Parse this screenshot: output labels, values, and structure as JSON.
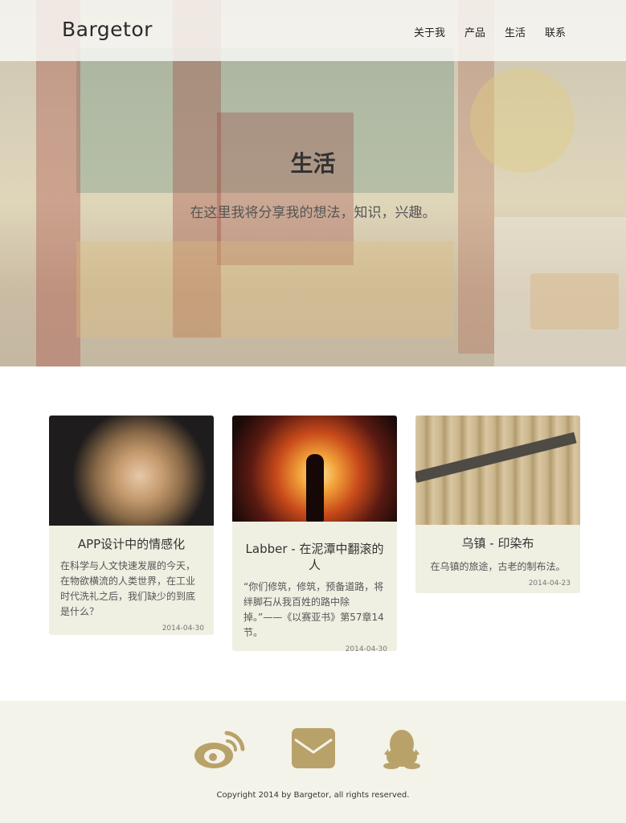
{
  "header": {
    "logo": "Bargetor",
    "nav": [
      "关于我",
      "产品",
      "生活",
      "联系"
    ]
  },
  "hero": {
    "title": "生活",
    "subtitle": "在这里我将分享我的想法，知识，兴趣。"
  },
  "cards": [
    {
      "title": "APP设计中的情感化",
      "desc": "在科学与人文快速发展的今天，在物欲横流的人类世界，在工业时代洗礼之后，我们缺少的到底是什么？",
      "date": "2014-04-30"
    },
    {
      "title": "Labber - 在泥潭中翻滚的人",
      "desc": "“你们修筑，修筑，预备道路，将绊脚石从我百姓的路中除掉。”——《以赛亚书》第57章14节。",
      "date": "2014-04-30"
    },
    {
      "title": "乌镇 - 印染布",
      "desc": "在乌镇的旅途，古老的制布法。",
      "date": "2014-04-23"
    }
  ],
  "footer": {
    "icons": [
      "weibo-icon",
      "mail-icon",
      "qq-icon"
    ],
    "copyright": "Copyright 2014 by Bargetor, all rights reserved."
  },
  "colors": {
    "icon": "#b9a26a",
    "card_bg": "#efefe2",
    "footer_bg": "#f4f3e9"
  }
}
